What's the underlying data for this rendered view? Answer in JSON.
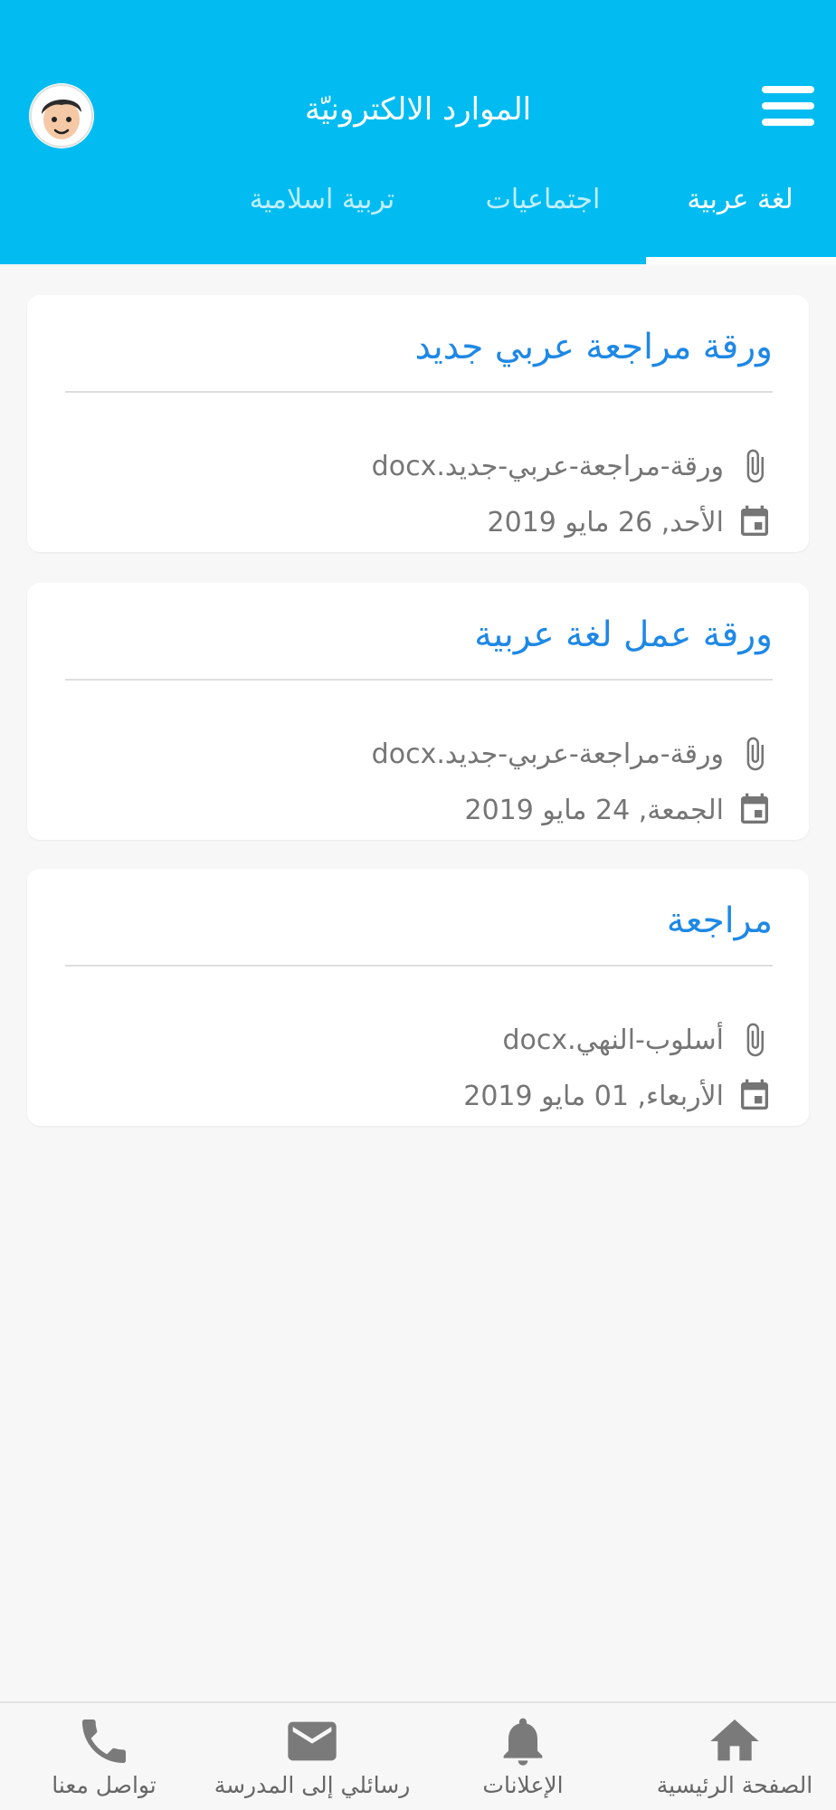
{
  "header": {
    "title": "الموارد الالكترونيّة",
    "color": "#02bcf1",
    "tabs": [
      {
        "label": "لغة عربية",
        "active": true
      },
      {
        "label": "اجتماعيات",
        "active": false
      },
      {
        "label": "تربية اسلامية",
        "active": false
      }
    ]
  },
  "resources": [
    {
      "title": "ورقة مراجعة عربي جديد",
      "file": "ورقة-مراجعة-عربي-جديد.docx",
      "date": "الأحد, 26 مايو 2019"
    },
    {
      "title": "ورقة عمل لغة عربية",
      "file": "ورقة-مراجعة-عربي-جديد.docx",
      "date": "الجمعة, 24 مايو 2019"
    },
    {
      "title": "مراجعة",
      "file": "أسلوب-النهي.docx",
      "date": "الأربعاء, 01 مايو 2019"
    }
  ],
  "bottom_nav": [
    {
      "label": "الصفحة الرئيسية",
      "icon": "home-icon"
    },
    {
      "label": "الإعلانات",
      "icon": "bell-icon"
    },
    {
      "label": "رسائلي إلى المدرسة",
      "icon": "mail-icon"
    },
    {
      "label": "تواصل معنا",
      "icon": "phone-icon"
    }
  ],
  "colors": {
    "accent": "#02bcf1",
    "title_blue": "#1e88e5",
    "meta_gray": "#757575"
  }
}
